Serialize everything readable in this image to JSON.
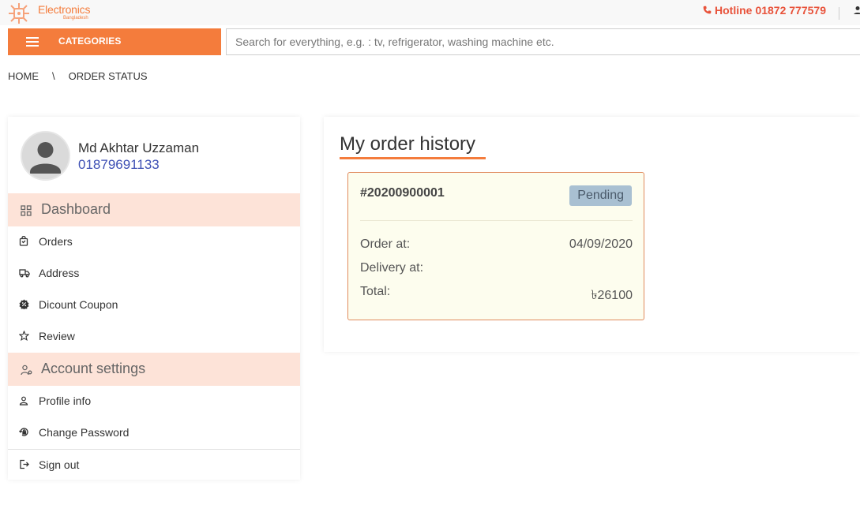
{
  "brand": {
    "name": "Electronics",
    "subtitle": "Bangladesh",
    "accent": "#f47c3c"
  },
  "hotline": {
    "label": "Hotline",
    "number": "01872 777579"
  },
  "nav": {
    "categories_label": "CATEGORIES",
    "search_placeholder": "Search for everything, e.g. : tv, refrigerator, washing machine etc."
  },
  "breadcrumb": {
    "home": "HOME",
    "separator": "\\",
    "current": "ORDER STATUS"
  },
  "profile": {
    "name": "Md Akhtar Uzzaman",
    "phone": "01879691133"
  },
  "sidebar": {
    "dashboard": {
      "label": "Dashboard",
      "icon": "dashboard-icon"
    },
    "dashboard_items": [
      {
        "label": "Orders",
        "icon": "bag-icon"
      },
      {
        "label": "Address",
        "icon": "truck-icon"
      },
      {
        "label": "Dicount Coupon",
        "icon": "coupon-icon"
      },
      {
        "label": "Review",
        "icon": "star-icon"
      }
    ],
    "account": {
      "label": "Account settings",
      "icon": "user-settings-icon"
    },
    "account_items": [
      {
        "label": "Profile info",
        "icon": "user-icon"
      },
      {
        "label": "Change Password",
        "icon": "lock-reset-icon"
      }
    ],
    "signout": {
      "label": "Sign out",
      "icon": "sign-out-icon"
    }
  },
  "main": {
    "title": "My order history",
    "order": {
      "number": "#20200900001",
      "status": "Pending",
      "order_at_label": "Order at:",
      "order_at": "04/09/2020",
      "delivery_at_label": "Delivery at:",
      "delivery_at": "",
      "total_label": "Total:",
      "total": "৳26100"
    }
  }
}
